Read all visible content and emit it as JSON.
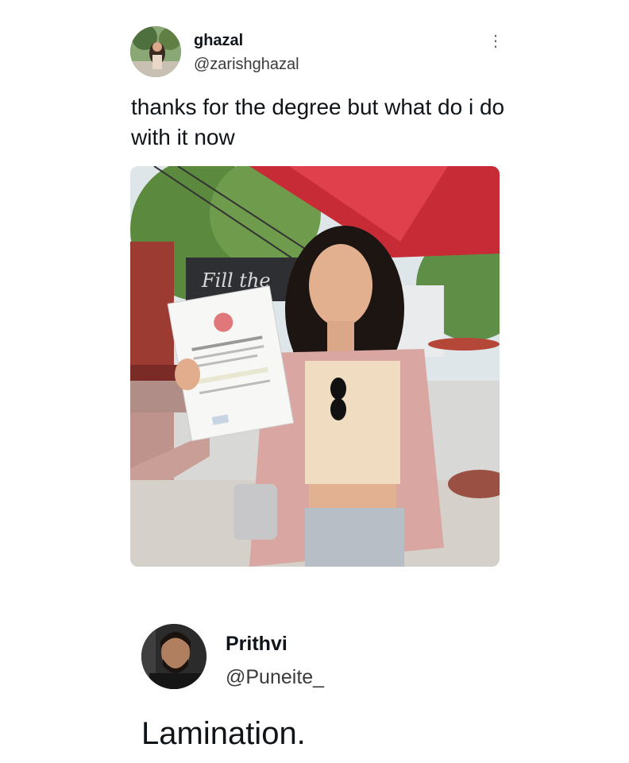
{
  "tweet1": {
    "name": "ghazal",
    "handle": "@zarishghazal",
    "text": "thanks for the degree but what do i do with it now",
    "more_icon": "vertical-ellipsis",
    "more_glyph": "⋮",
    "image_sign_text": "Fill the"
  },
  "tweet2": {
    "name": "Prithvi",
    "handle": "@Puneite_",
    "text": "Lamination."
  }
}
